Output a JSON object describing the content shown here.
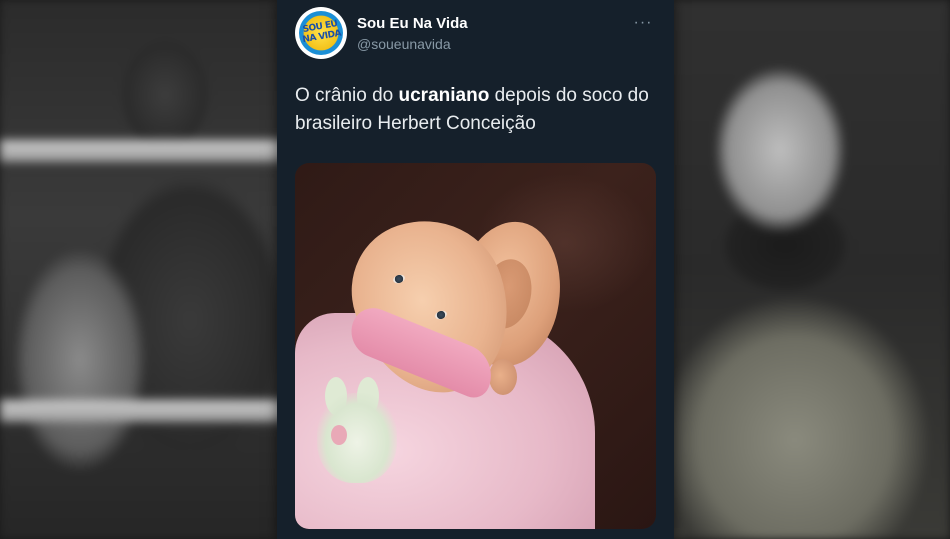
{
  "tweet": {
    "display_name": "Sou Eu Na Vida",
    "handle": "@soueunavida",
    "avatar_logo": "SOU EU NA VIDA",
    "more_icon": "more-options-icon",
    "text_before": "O crânio do ",
    "text_bold": "ucraniano",
    "text_after": " depois do soco do brasileiro Herbert Conceição",
    "media_description": "doll-with-dented-head-photo"
  },
  "colors": {
    "card_background": "#15202b",
    "text_primary": "#ffffff",
    "text_secondary": "#8899a6"
  }
}
